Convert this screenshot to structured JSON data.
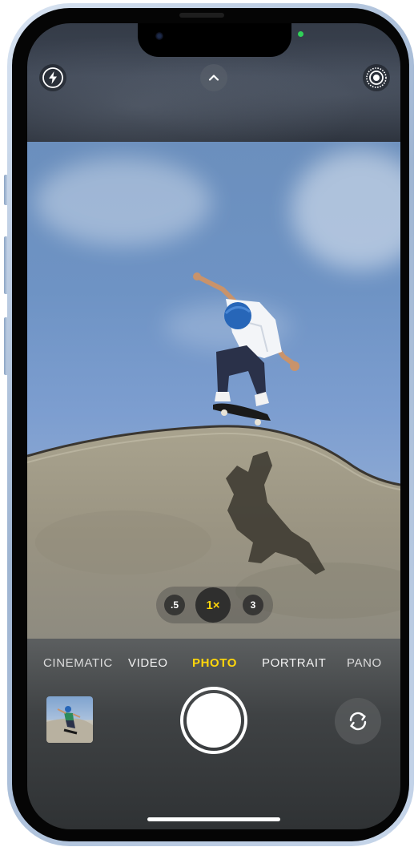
{
  "camera": {
    "top_controls": {
      "flash": "flash-icon",
      "controls_toggle": "chevron-up-icon",
      "live_photo": "live-photo-icon"
    },
    "zoom": {
      "levels": [
        ".5",
        "1×",
        "3"
      ],
      "selected": "1×"
    },
    "modes": {
      "items": [
        "CINEMATIC",
        "VIDEO",
        "PHOTO",
        "PORTRAIT",
        "PANO"
      ],
      "selected": "PHOTO"
    },
    "colors": {
      "accent": "#ffd60a",
      "recording_indicator": "#30d158"
    },
    "bottom_controls": {
      "last_photo": "photo-thumbnail",
      "shutter": "shutter-button",
      "switch_camera": "camera-flip-icon"
    }
  }
}
